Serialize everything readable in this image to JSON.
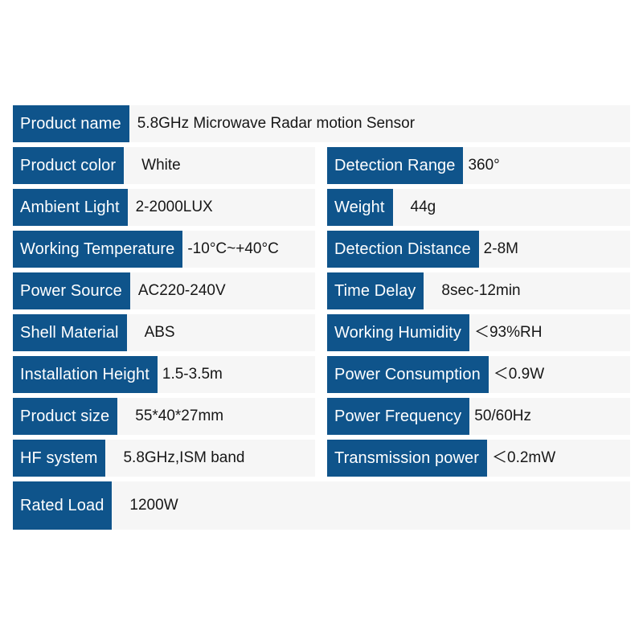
{
  "table": {
    "accent_color": "#0f548b",
    "value_bg_color": "#f6f6f6",
    "label_text_color": "#ffffff",
    "value_text_color": "#171717",
    "rows": [
      {
        "span": "full",
        "left": {
          "label": "Product name",
          "value": "5.8GHz Microwave Radar motion Sensor"
        }
      },
      {
        "span": "half",
        "left": {
          "label": "Product color",
          "value": "White"
        },
        "right": {
          "label": "Detection Range",
          "value": "360°"
        }
      },
      {
        "span": "half",
        "left": {
          "label": "Ambient Light",
          "value": "2-2000LUX"
        },
        "right": {
          "label": "Weight",
          "value": "44g"
        }
      },
      {
        "span": "half",
        "left": {
          "label": "Working Temperature",
          "value": "-10°C~+40°C"
        },
        "right": {
          "label": "Detection Distance",
          "value": "2-8M"
        }
      },
      {
        "span": "half",
        "left": {
          "label": "Power Source",
          "value": "AC220-240V"
        },
        "right": {
          "label": "Time Delay",
          "value": "8sec-12min"
        }
      },
      {
        "span": "half",
        "left": {
          "label": "Shell Material",
          "value": "ABS"
        },
        "right": {
          "label": "Working Humidity",
          "value": "＜93%RH"
        }
      },
      {
        "span": "half",
        "left": {
          "label": "Installation Height",
          "value": "1.5-3.5m"
        },
        "right": {
          "label": "Power Consumption",
          "value": "＜0.9W"
        }
      },
      {
        "span": "half",
        "left": {
          "label": "Product size",
          "value": "55*40*27mm"
        },
        "right": {
          "label": "Power Frequency",
          "value": "50/60Hz"
        }
      },
      {
        "span": "half",
        "left": {
          "label": "HF system",
          "value": "5.8GHz,ISM band"
        },
        "right": {
          "label": "Transmission power",
          "value": "＜0.2mW"
        }
      },
      {
        "span": "full-last",
        "left": {
          "label": "Rated Load",
          "value": "1200W"
        }
      }
    ]
  }
}
